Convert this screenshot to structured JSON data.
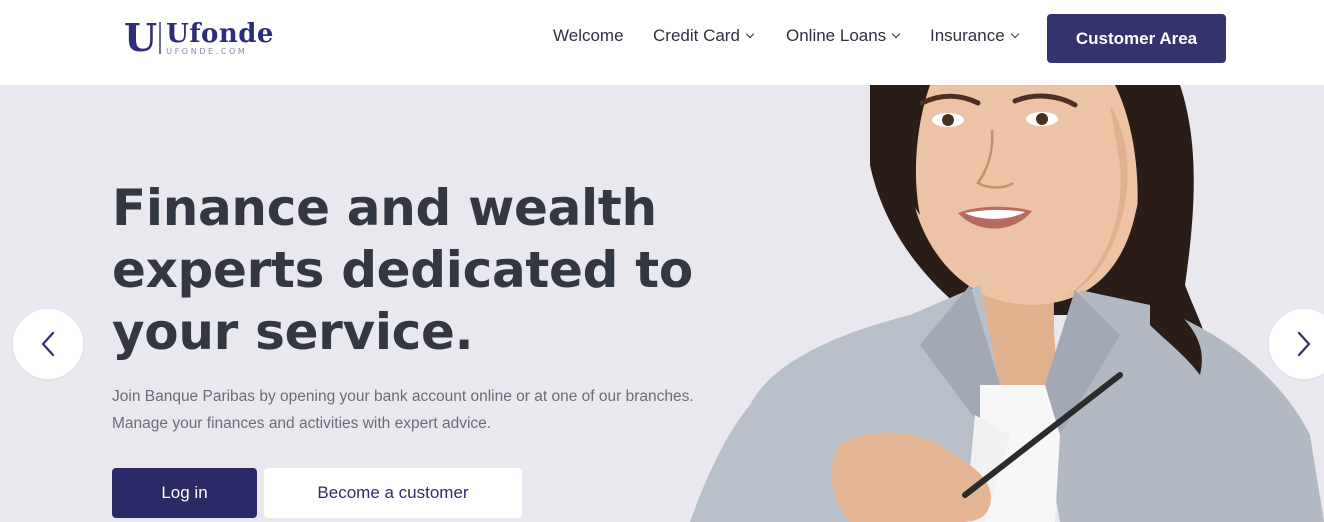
{
  "header": {
    "logo": {
      "mark": "U",
      "name": "Ufonde",
      "subtitle": "UFONDE.COM"
    },
    "nav": [
      {
        "label": "Welcome",
        "has_dropdown": false
      },
      {
        "label": "Credit Card",
        "has_dropdown": true
      },
      {
        "label": "Online Loans",
        "has_dropdown": true
      },
      {
        "label": "Insurance",
        "has_dropdown": true
      }
    ],
    "cta_label": "Customer Area"
  },
  "hero": {
    "title_lines": [
      "Finance and wealth",
      "experts dedicated to",
      "your service."
    ],
    "description_lines": [
      "Join Banque Paribas by opening your bank account online or at one of our branches.",
      "Manage your finances and activities with expert advice."
    ],
    "login_label": "Log in",
    "become_label": "Become a customer"
  },
  "carousel": {
    "prev_icon": "chevron-left-icon",
    "next_icon": "chevron-right-icon"
  },
  "colors": {
    "brand": "#35336e",
    "hero_background": "#e8e8ee",
    "heading": "#333741",
    "body_text": "#6a6d78"
  }
}
